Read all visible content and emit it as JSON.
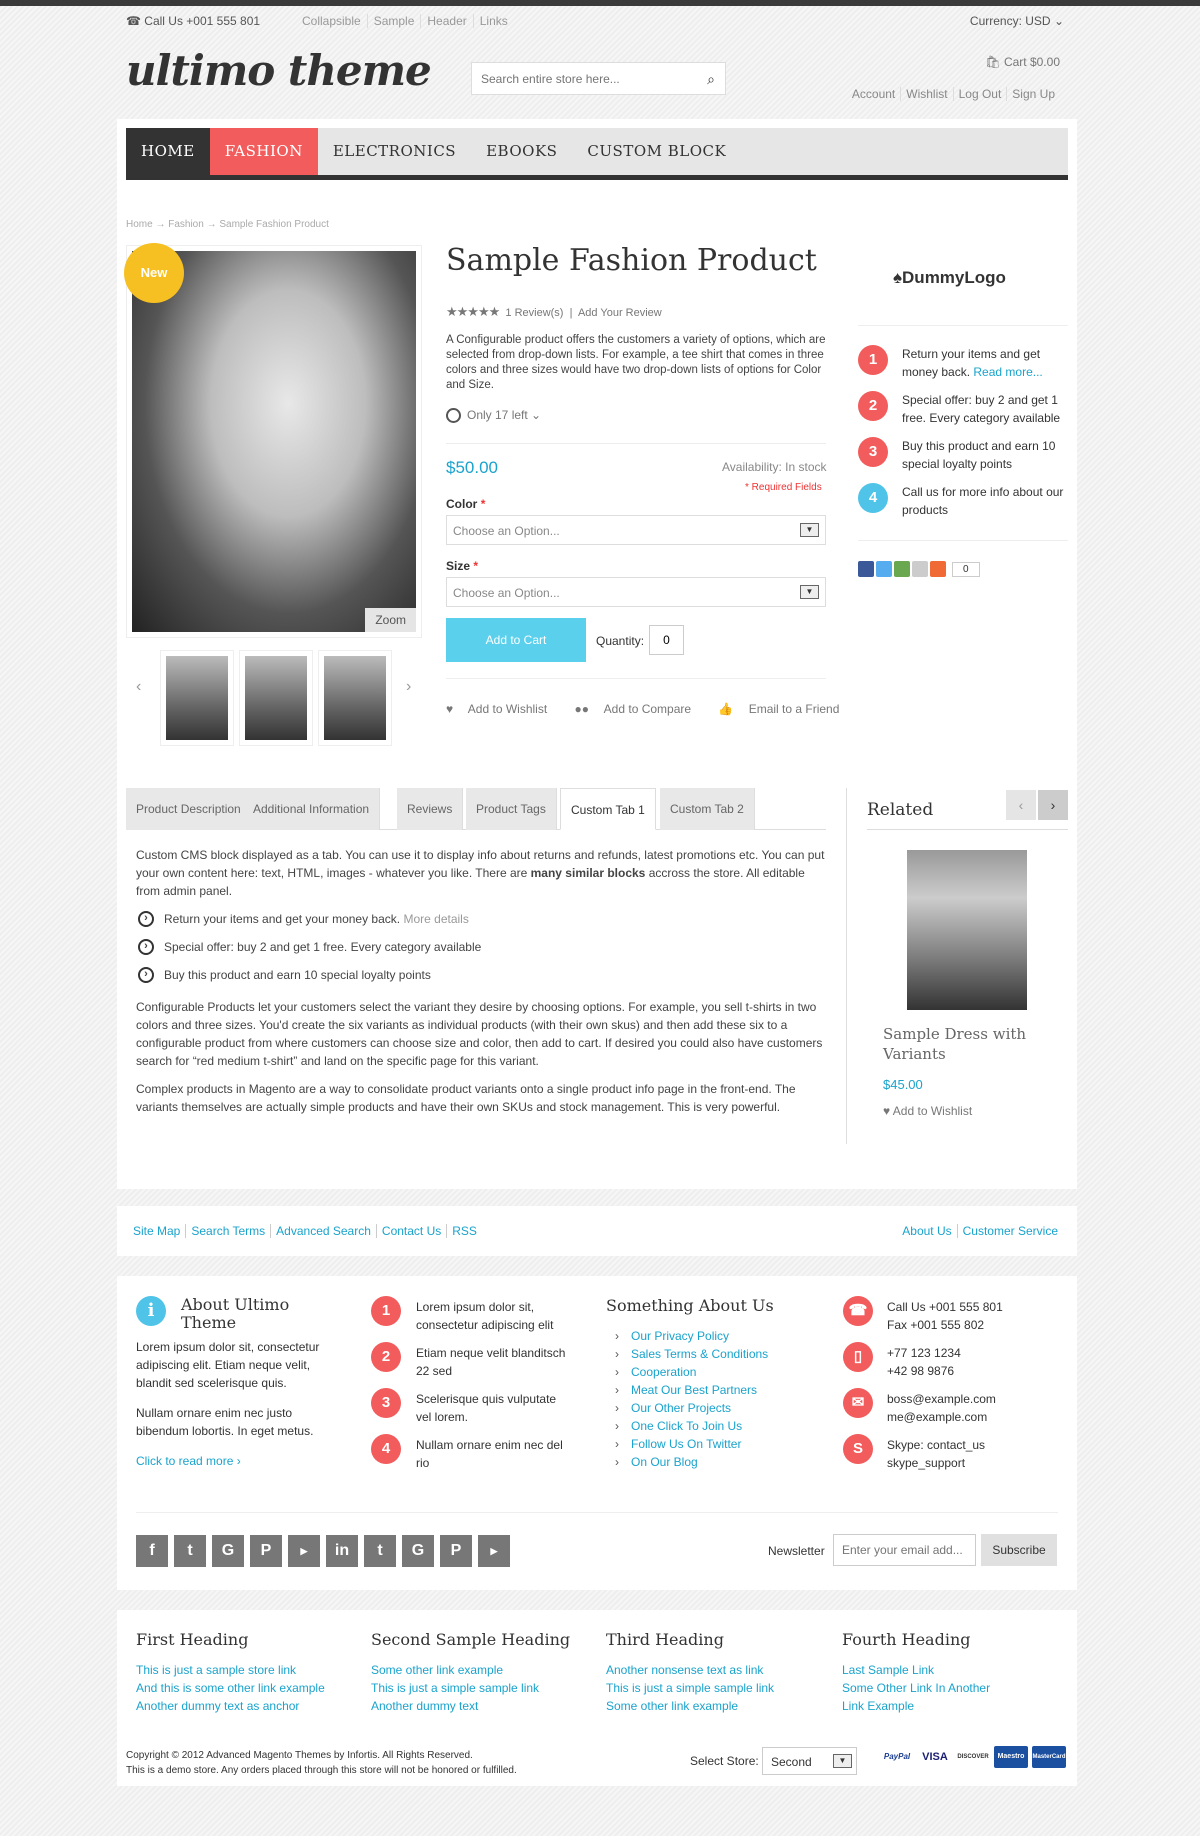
{
  "topbar": {
    "phone": "Call Us +001 555 801",
    "links": [
      "Collapsible",
      "Sample",
      "Header",
      "Links"
    ],
    "currency": "Currency: USD"
  },
  "header": {
    "logo": "ultimo theme",
    "search_placeholder": "Search entire store here...",
    "cart": "Cart $0.00",
    "account_links": [
      "Account",
      "Wishlist",
      "Log Out",
      "Sign Up"
    ]
  },
  "nav": [
    "HOME",
    "FASHION",
    "ELECTRONICS",
    "EBOOKS",
    "CUSTOM BLOCK"
  ],
  "breadcrumb": "Home → Fashion → Sample Fashion Product",
  "product": {
    "badge": "New",
    "zoom": "Zoom",
    "title": "Sample Fashion Product",
    "stars": "★★★★★",
    "reviews": "1 Review(s)",
    "add_review": "Add Your Review",
    "description": "A Configurable product offers the customers a variety of options, which are selected from drop-down lists. For example, a tee shirt that comes in three colors and three sizes would have two drop-down lists of options for Color and Size.",
    "only_left": "Only 17 left",
    "price": "$50.00",
    "availability": "Availability: In stock",
    "required": "* Required Fields",
    "color_label": "Color",
    "size_label": "Size",
    "choose_option": "Choose an Option...",
    "add_to_cart": "Add to Cart",
    "quantity_label": "Quantity:",
    "quantity": "0",
    "add_to_wishlist": "Add to Wishlist",
    "add_to_compare": "Add to Compare",
    "email_friend": "Email to a Friend"
  },
  "sidebar": {
    "logo": "DummyLogo",
    "features": [
      {
        "num": "1",
        "text": "Return your items and get money back.",
        "link": "Read more..."
      },
      {
        "num": "2",
        "text": "Special offer: buy 2 and get 1 free. Every category available"
      },
      {
        "num": "3",
        "text": "Buy this product and earn 10 special loyalty points"
      },
      {
        "num": "4",
        "text": "Call us for more info about our products"
      }
    ],
    "share_count": "0"
  },
  "tabs": [
    "Product Description",
    "Additional Information",
    "Reviews",
    "Product Tags",
    "Custom Tab 1",
    "Custom Tab 2"
  ],
  "tab_body": {
    "p1a": "Custom CMS block displayed as a tab. You can use it to display info about returns and refunds, latest promotions etc. You can put your own content here: text, HTML, images - whatever you like. There are ",
    "p1b": "many similar blocks",
    "p1c": " accross the store. All editable from admin panel.",
    "b1": "Return your items and get your money back.",
    "b1link": "More details",
    "b2": "Special offer: buy 2 and get 1 free. Every category available",
    "b3": "Buy this product and earn 10 special loyalty points",
    "p2": "Configurable Products let your customers select the variant they desire by choosing options. For example, you sell t-shirts in two colors and three sizes. You'd create the six variants as individual products (with their own skus) and then add these six to a configurable product from where customers can choose size and color, then add to cart. If desired you could also have customers search for “red medium t-shirt” and land on the specific page for this variant.",
    "p3": "Complex products in Magento are a way to consolidate product variants onto a single product info page in the front-end. The variants themselves are actually simple products and have their own SKUs and stock management. This is very powerful."
  },
  "related": {
    "heading": "Related",
    "title": "Sample Dress with Variants",
    "price": "$45.00",
    "wishlist": "Add to Wishlist"
  },
  "footer_links": {
    "left": [
      "Site Map",
      "Search Terms",
      "Advanced Search",
      "Contact Us",
      "RSS"
    ],
    "right": [
      "About Us",
      "Customer Service"
    ]
  },
  "footer": {
    "about_heading": "About Ultimo Theme",
    "about_p1": "Lorem ipsum dolor sit, consectetur adipiscing elit. Etiam neque velit, blandit sed scelerisque quis.",
    "about_p2": "Nullam ornare enim nec justo bibendum lobortis. In eget metus.",
    "read_more": "Click to read more",
    "numbered": [
      {
        "num": "1",
        "text": "Lorem ipsum dolor sit, consectetur adipiscing elit"
      },
      {
        "num": "2",
        "text": "Etiam neque velit blanditsch 22 sed"
      },
      {
        "num": "3",
        "text": "Scelerisque quis vulputate vel lorem."
      },
      {
        "num": "4",
        "text": "Nullam ornare enim nec del rio"
      }
    ],
    "something_heading": "Something About Us",
    "something_links": [
      "Our Privacy Policy",
      "Sales Terms & Conditions",
      "Cooperation",
      "Meat Our Best Partners",
      "Our Other Projects",
      "One Click To Join Us",
      "Follow Us On Twitter",
      "On Our Blog"
    ],
    "contact": [
      {
        "line1": "Call Us +001 555 801",
        "line2": "Fax +001 555 802"
      },
      {
        "line1": "+77 123 1234",
        "line2": "+42 98 9876"
      },
      {
        "line1": "boss@example.com",
        "line2": "me@example.com"
      },
      {
        "line1": "Skype: contact_us",
        "line2": "skype_support"
      }
    ],
    "newsletter_label": "Newsletter",
    "newsletter_placeholder": "Enter your email add...",
    "subscribe": "Subscribe"
  },
  "bottom": {
    "columns": [
      {
        "heading": "First Heading",
        "links": [
          "This is just a sample store link",
          "And this is some other link example",
          "Another dummy text as anchor"
        ]
      },
      {
        "heading": "Second Sample Heading",
        "links": [
          "Some other link example",
          "This is just a simple sample link",
          "Another dummy text"
        ]
      },
      {
        "heading": "Third Heading",
        "links": [
          "Another nonsense text as link",
          "This is just a simple sample link",
          "Some other link example"
        ]
      },
      {
        "heading": "Fourth Heading",
        "links": [
          "Last Sample Link",
          "Some Other Link In Another",
          "Link Example"
        ]
      }
    ],
    "copyright": "Copyright © 2012 Advanced Magento Themes by Infortis. All Rights Reserved.",
    "demo_note": "This is a demo store. Any orders placed through this store will not be honored or fulfilled.",
    "store_label": "Select Store:",
    "store_value": "Second",
    "cards": [
      "PayPal",
      "VISA",
      "DISCOVER",
      "Maestro",
      "MasterCard"
    ]
  },
  "colors": {
    "accent_red": "#f25c5c",
    "accent_blue": "#1aa3cc",
    "cta": "#5bd0ec",
    "badge": "#f7c022"
  }
}
